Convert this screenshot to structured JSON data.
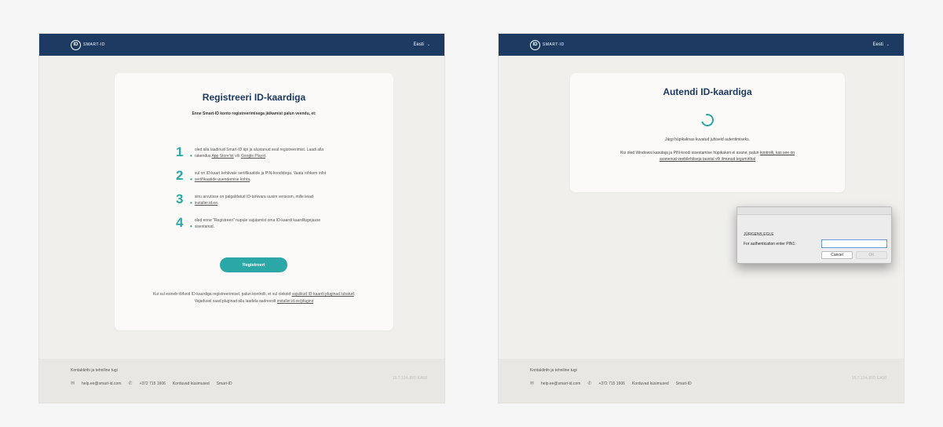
{
  "brand": {
    "logo_letter": "ID",
    "name": "SMART-ID"
  },
  "header": {
    "language": "Eesti",
    "chevron": "⌄"
  },
  "register": {
    "title": "Registreeri ID-kaardiga",
    "intro": "Enne Smart-ID konto registreerimisega jätkamist palun veendu, et:",
    "steps": [
      {
        "num": "1",
        "text": "oled alla laadinud Smart-ID äpi ja alustanud seal registreerimist. Laadi alla rakendus ",
        "link1": "App Store'ist",
        "mid": " või ",
        "link2": "Google Playst",
        "end": "."
      },
      {
        "num": "2",
        "text": "sul on ID-kaart kehtivate sertifikaatide ja PIN-koodidega. Vaata rohkem infot ",
        "link1": "sertifikaatide uuendamise kohta",
        "end": "."
      },
      {
        "num": "3",
        "text": "sinu arvutisse on paigaldatud ID-tarkvara uusim versioon, mille leiad ",
        "link1": "installer.id.ee",
        "end": "."
      },
      {
        "num": "4",
        "text": "oled enne \"Registreeri\" nupule vajutamist oma ID-kaardi kaardilugejasse sisestanud.",
        "link1": "",
        "end": ""
      }
    ],
    "button": "Registreeri",
    "foot_a": "Kui sul esineb tõrkeid ID-kaardiga registreerimisel, palun kontrolli, et sul oleksid ",
    "foot_link1": "vajalikud ID-kaardi pluginad lubatud",
    "foot_b": ". Vajadusel saad pluginad alla laadida aadressilt ",
    "foot_link2": "installer.id.ee/plugins"
  },
  "auth": {
    "title": "Autendi ID-kaardiga",
    "line1": "Järgi hüpikaknas kuvatud juhiseid autentimiseks.",
    "line2": "Kui oled Windowsi kasutaja ja PIN-koodi sisestamise hüpikaken ei avane, palun ",
    "line2_link": "kontrolli, kas see on avanenud veebilehitseja taustal või ilmunud tegumiribal"
  },
  "dialog": {
    "name": "JÜRGENS,EGLE",
    "label": "For authentication enter PIN1:",
    "cancel": "Cancel",
    "ok": "OK"
  },
  "footer": {
    "title": "Kontaktinfo ja tehniline tugi",
    "email_icon": "✉",
    "email": "help.ee@smart-id.com",
    "phone_icon": "✆",
    "phone": "+372 715 1606",
    "faq": "Korduvad küsimused",
    "smartid": "Smart-ID",
    "version": "15.7.124.JRD.EA58"
  }
}
